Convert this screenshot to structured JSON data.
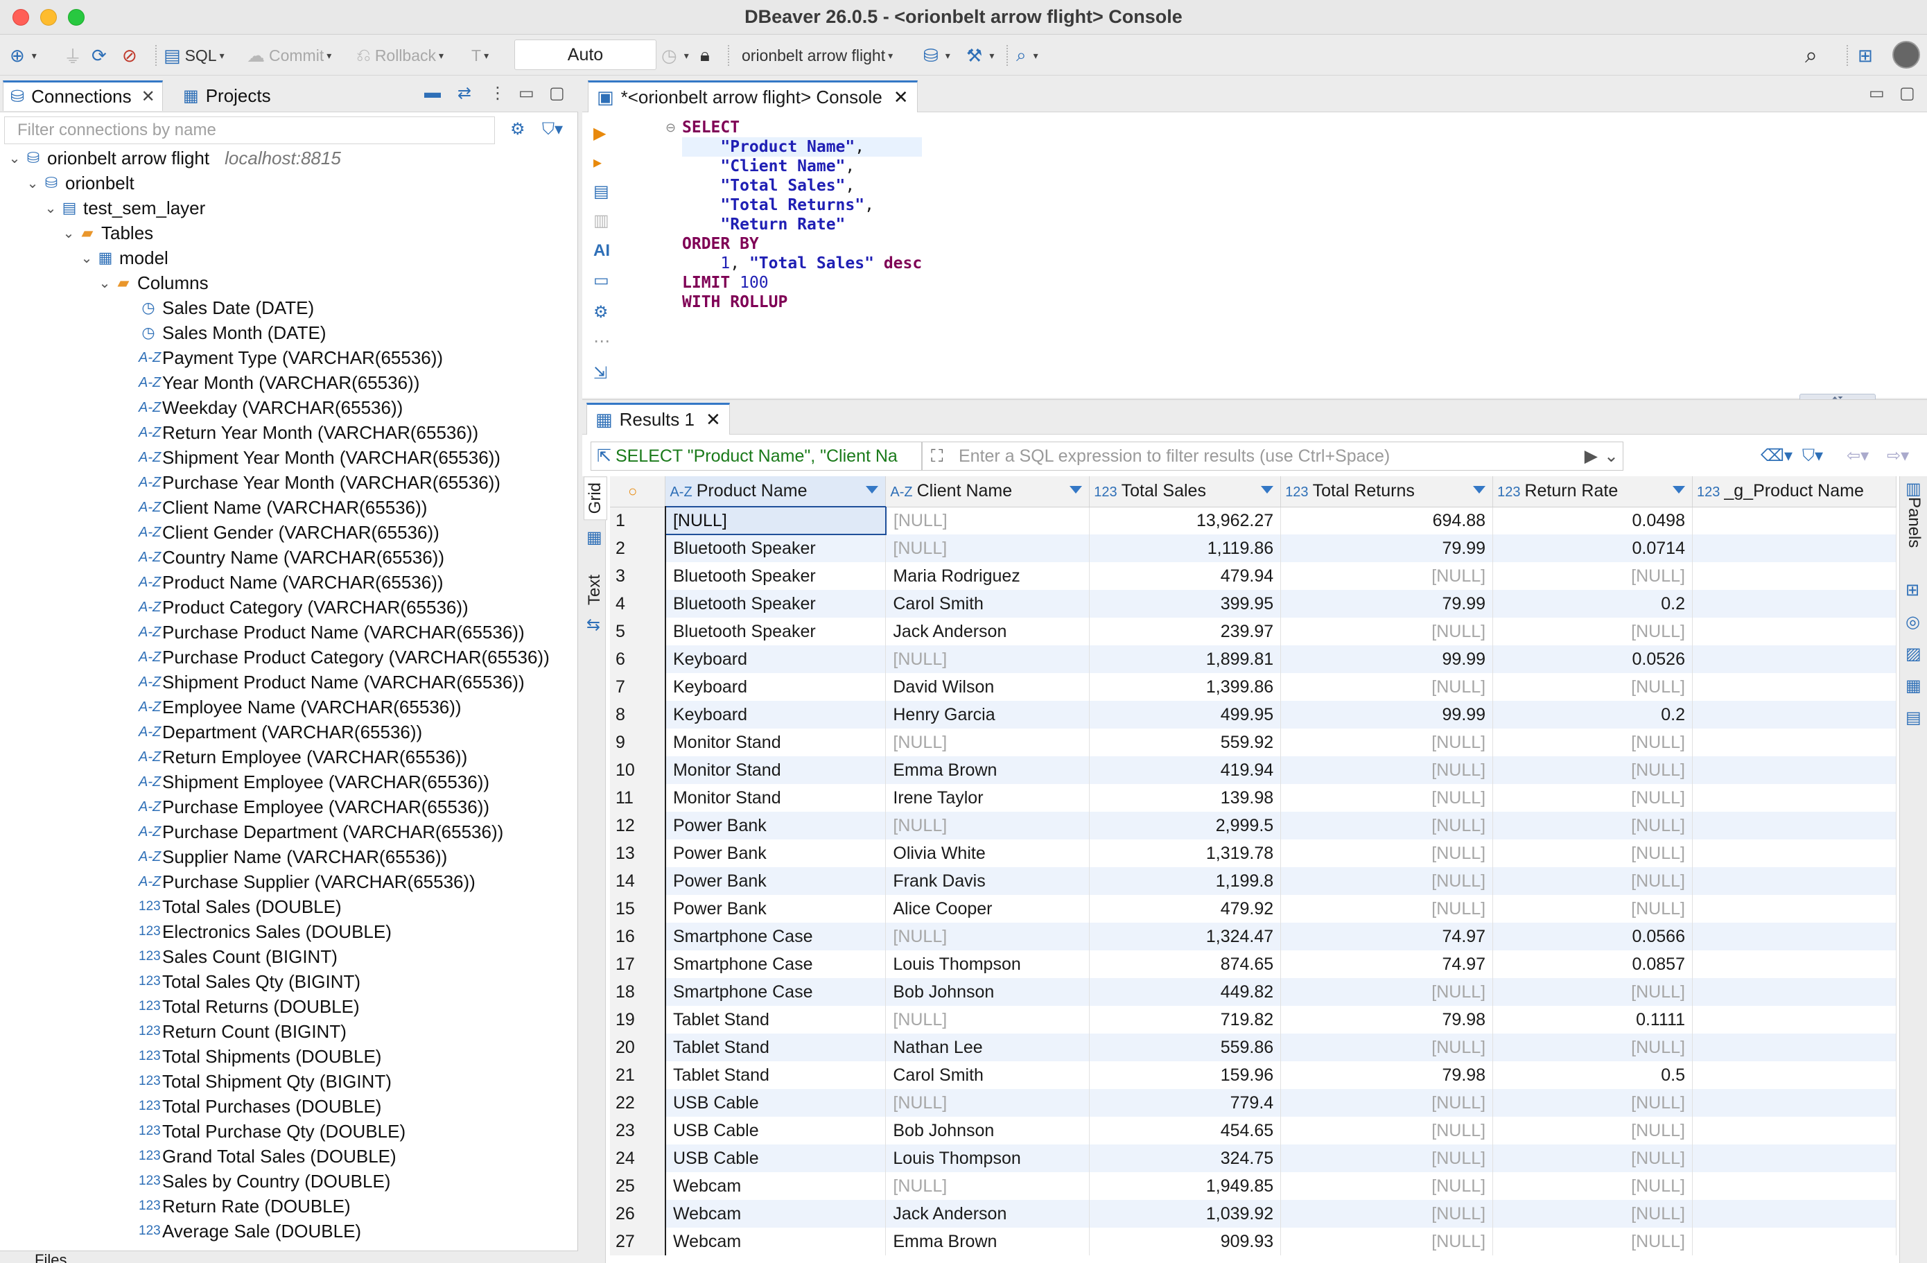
{
  "window": {
    "title": "DBeaver 26.0.5 - <orionbelt arrow flight> Console"
  },
  "toolbar": {
    "sql_label": "SQL",
    "commit_label": "Commit",
    "rollback_label": "Rollback",
    "t_label": "T",
    "auto_value": "Auto",
    "connection_label": "orionbelt arrow flight"
  },
  "left": {
    "tabs": [
      {
        "label": "Connections"
      },
      {
        "label": "Projects"
      }
    ],
    "filter_placeholder": "Filter connections by name",
    "connection": {
      "name": "orionbelt arrow flight",
      "host": "localhost:8815"
    },
    "catalog": "orionbelt",
    "schema": "test_sem_layer",
    "tables_folder": "Tables",
    "table": "model",
    "columns_folder": "Columns",
    "columns": [
      {
        "label": "Sales Date (DATE)",
        "icon": "clock-icon"
      },
      {
        "label": "Sales Month (DATE)",
        "icon": "clock-icon"
      },
      {
        "label": "Payment Type (VARCHAR(65536))",
        "icon": "text-type-icon"
      },
      {
        "label": "Year Month (VARCHAR(65536))",
        "icon": "text-type-icon"
      },
      {
        "label": "Weekday (VARCHAR(65536))",
        "icon": "text-type-icon"
      },
      {
        "label": "Return Year Month (VARCHAR(65536))",
        "icon": "text-type-icon"
      },
      {
        "label": "Shipment Year Month (VARCHAR(65536))",
        "icon": "text-type-icon"
      },
      {
        "label": "Purchase Year Month (VARCHAR(65536))",
        "icon": "text-type-icon"
      },
      {
        "label": "Client Name (VARCHAR(65536))",
        "icon": "text-type-icon"
      },
      {
        "label": "Client Gender (VARCHAR(65536))",
        "icon": "text-type-icon"
      },
      {
        "label": "Country Name (VARCHAR(65536))",
        "icon": "text-type-icon"
      },
      {
        "label": "Product Name (VARCHAR(65536))",
        "icon": "text-type-icon"
      },
      {
        "label": "Product Category (VARCHAR(65536))",
        "icon": "text-type-icon"
      },
      {
        "label": "Purchase Product Name (VARCHAR(65536))",
        "icon": "text-type-icon"
      },
      {
        "label": "Purchase Product Category (VARCHAR(65536))",
        "icon": "text-type-icon"
      },
      {
        "label": "Shipment Product Name (VARCHAR(65536))",
        "icon": "text-type-icon"
      },
      {
        "label": "Employee Name (VARCHAR(65536))",
        "icon": "text-type-icon"
      },
      {
        "label": "Department (VARCHAR(65536))",
        "icon": "text-type-icon"
      },
      {
        "label": "Return Employee (VARCHAR(65536))",
        "icon": "text-type-icon"
      },
      {
        "label": "Shipment Employee (VARCHAR(65536))",
        "icon": "text-type-icon"
      },
      {
        "label": "Purchase Employee (VARCHAR(65536))",
        "icon": "text-type-icon"
      },
      {
        "label": "Purchase Department (VARCHAR(65536))",
        "icon": "text-type-icon"
      },
      {
        "label": "Supplier Name (VARCHAR(65536))",
        "icon": "text-type-icon"
      },
      {
        "label": "Purchase Supplier (VARCHAR(65536))",
        "icon": "text-type-icon"
      },
      {
        "label": "Total Sales (DOUBLE)",
        "icon": "number-type-icon"
      },
      {
        "label": "Electronics Sales (DOUBLE)",
        "icon": "number-type-icon"
      },
      {
        "label": "Sales Count (BIGINT)",
        "icon": "number-type-icon"
      },
      {
        "label": "Total Sales Qty (BIGINT)",
        "icon": "number-type-icon"
      },
      {
        "label": "Total Returns (DOUBLE)",
        "icon": "number-type-icon"
      },
      {
        "label": "Return Count (BIGINT)",
        "icon": "number-type-icon"
      },
      {
        "label": "Total Shipments (DOUBLE)",
        "icon": "number-type-icon"
      },
      {
        "label": "Total Shipment Qty (BIGINT)",
        "icon": "number-type-icon"
      },
      {
        "label": "Total Purchases (DOUBLE)",
        "icon": "number-type-icon"
      },
      {
        "label": "Total Purchase Qty (DOUBLE)",
        "icon": "number-type-icon"
      },
      {
        "label": "Grand Total Sales (DOUBLE)",
        "icon": "number-type-icon"
      },
      {
        "label": "Sales by Country (DOUBLE)",
        "icon": "number-type-icon"
      },
      {
        "label": "Return Rate (DOUBLE)",
        "icon": "number-type-icon"
      },
      {
        "label": "Average Sale (DOUBLE)",
        "icon": "number-type-icon"
      }
    ],
    "files_tab": "Files"
  },
  "editor": {
    "tab_label": "*<orionbelt arrow flight> Console",
    "sql_lines": [
      [
        {
          "t": "SELECT",
          "c": "kw"
        }
      ],
      [
        {
          "t": "    "
        },
        {
          "t": "\"Product Name\"",
          "c": "str"
        },
        {
          "t": ","
        }
      ],
      [
        {
          "t": "    "
        },
        {
          "t": "\"Client Name\"",
          "c": "str"
        },
        {
          "t": ","
        }
      ],
      [
        {
          "t": "    "
        },
        {
          "t": "\"Total Sales\"",
          "c": "str"
        },
        {
          "t": ","
        }
      ],
      [
        {
          "t": "    "
        },
        {
          "t": "\"Total Returns\"",
          "c": "str"
        },
        {
          "t": ","
        }
      ],
      [
        {
          "t": "    "
        },
        {
          "t": "\"Return Rate\"",
          "c": "str"
        }
      ],
      [
        {
          "t": "ORDER BY",
          "c": "kw"
        }
      ],
      [
        {
          "t": "    "
        },
        {
          "t": "1",
          "c": "numl"
        },
        {
          "t": ", "
        },
        {
          "t": "\"Total Sales\"",
          "c": "str"
        },
        {
          "t": " "
        },
        {
          "t": "desc",
          "c": "kw"
        }
      ],
      [
        {
          "t": "LIMIT",
          "c": "kw"
        },
        {
          "t": " "
        },
        {
          "t": "100",
          "c": "numl"
        }
      ],
      [
        {
          "t": "WITH ROLLUP",
          "c": "kw"
        }
      ]
    ]
  },
  "results": {
    "tab_label": "Results 1",
    "query_chip": "SELECT \"Product Name\", \"Client Na",
    "filter_placeholder": "Enter a SQL expression to filter results (use Ctrl+Space)",
    "side_tabs": {
      "grid": "Grid",
      "text": "Text"
    },
    "panels_label": "Panels",
    "columns": [
      {
        "label": "Product Name",
        "type": "A-Z"
      },
      {
        "label": "Client Name",
        "type": "A-Z"
      },
      {
        "label": "Total Sales",
        "type": "123"
      },
      {
        "label": "Total Returns",
        "type": "123"
      },
      {
        "label": "Return Rate",
        "type": "123"
      },
      {
        "label": "_g_Product Name",
        "type": "123"
      }
    ],
    "rows": [
      [
        "1",
        "[NULL]",
        "[NULL]",
        "13,962.27",
        "694.88",
        "0.0498",
        ""
      ],
      [
        "2",
        "Bluetooth Speaker",
        "[NULL]",
        "1,119.86",
        "79.99",
        "0.0714",
        ""
      ],
      [
        "3",
        "Bluetooth Speaker",
        "Maria Rodriguez",
        "479.94",
        "[NULL]",
        "[NULL]",
        ""
      ],
      [
        "4",
        "Bluetooth Speaker",
        "Carol Smith",
        "399.95",
        "79.99",
        "0.2",
        ""
      ],
      [
        "5",
        "Bluetooth Speaker",
        "Jack Anderson",
        "239.97",
        "[NULL]",
        "[NULL]",
        ""
      ],
      [
        "6",
        "Keyboard",
        "[NULL]",
        "1,899.81",
        "99.99",
        "0.0526",
        ""
      ],
      [
        "7",
        "Keyboard",
        "David Wilson",
        "1,399.86",
        "[NULL]",
        "[NULL]",
        ""
      ],
      [
        "8",
        "Keyboard",
        "Henry Garcia",
        "499.95",
        "99.99",
        "0.2",
        ""
      ],
      [
        "9",
        "Monitor Stand",
        "[NULL]",
        "559.92",
        "[NULL]",
        "[NULL]",
        ""
      ],
      [
        "10",
        "Monitor Stand",
        "Emma Brown",
        "419.94",
        "[NULL]",
        "[NULL]",
        ""
      ],
      [
        "11",
        "Monitor Stand",
        "Irene Taylor",
        "139.98",
        "[NULL]",
        "[NULL]",
        ""
      ],
      [
        "12",
        "Power Bank",
        "[NULL]",
        "2,999.5",
        "[NULL]",
        "[NULL]",
        ""
      ],
      [
        "13",
        "Power Bank",
        "Olivia White",
        "1,319.78",
        "[NULL]",
        "[NULL]",
        ""
      ],
      [
        "14",
        "Power Bank",
        "Frank Davis",
        "1,199.8",
        "[NULL]",
        "[NULL]",
        ""
      ],
      [
        "15",
        "Power Bank",
        "Alice Cooper",
        "479.92",
        "[NULL]",
        "[NULL]",
        ""
      ],
      [
        "16",
        "Smartphone Case",
        "[NULL]",
        "1,324.47",
        "74.97",
        "0.0566",
        ""
      ],
      [
        "17",
        "Smartphone Case",
        "Louis Thompson",
        "874.65",
        "74.97",
        "0.0857",
        ""
      ],
      [
        "18",
        "Smartphone Case",
        "Bob Johnson",
        "449.82",
        "[NULL]",
        "[NULL]",
        ""
      ],
      [
        "19",
        "Tablet Stand",
        "[NULL]",
        "719.82",
        "79.98",
        "0.1111",
        ""
      ],
      [
        "20",
        "Tablet Stand",
        "Nathan Lee",
        "559.86",
        "[NULL]",
        "[NULL]",
        ""
      ],
      [
        "21",
        "Tablet Stand",
        "Carol Smith",
        "159.96",
        "79.98",
        "0.5",
        ""
      ],
      [
        "22",
        "USB Cable",
        "[NULL]",
        "779.4",
        "[NULL]",
        "[NULL]",
        ""
      ],
      [
        "23",
        "USB Cable",
        "Bob Johnson",
        "454.65",
        "[NULL]",
        "[NULL]",
        ""
      ],
      [
        "24",
        "USB Cable",
        "Louis Thompson",
        "324.75",
        "[NULL]",
        "[NULL]",
        ""
      ],
      [
        "25",
        "Webcam",
        "[NULL]",
        "1,949.85",
        "[NULL]",
        "[NULL]",
        ""
      ],
      [
        "26",
        "Webcam",
        "Jack Anderson",
        "1,039.92",
        "[NULL]",
        "[NULL]",
        ""
      ],
      [
        "27",
        "Webcam",
        "Emma Brown",
        "909.93",
        "[NULL]",
        "[NULL]",
        ""
      ]
    ]
  },
  "colors": {
    "accent": "#3478c6",
    "keyword": "#7f0055",
    "string": "#1f1fb4",
    "null_text": "#a7a7a7",
    "row_alt": "#edf3fc"
  }
}
